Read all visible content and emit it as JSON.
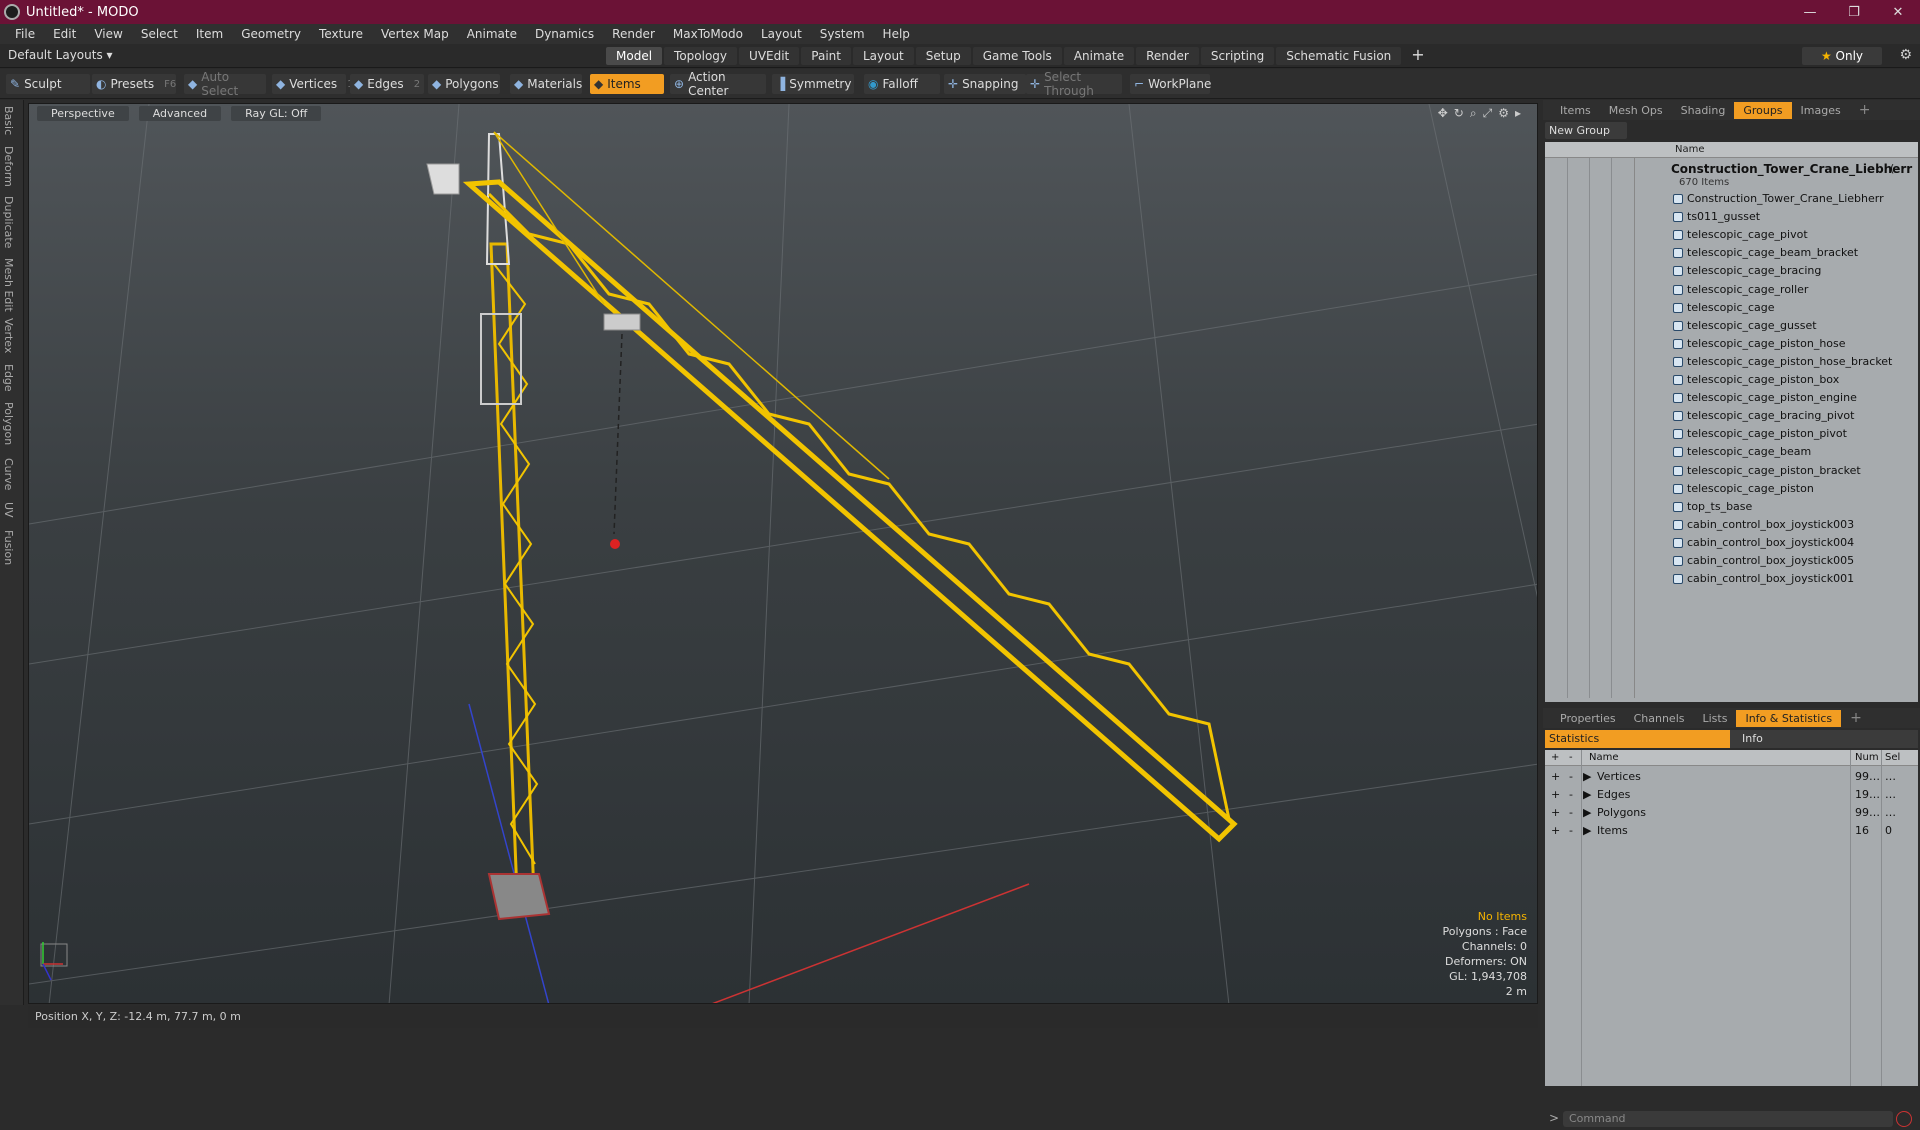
{
  "window": {
    "title": "Untitled* - MODO"
  },
  "menu": [
    "File",
    "Edit",
    "View",
    "Select",
    "Item",
    "Geometry",
    "Texture",
    "Vertex Map",
    "Animate",
    "Dynamics",
    "Render",
    "MaxToModo",
    "Layout",
    "System",
    "Help"
  ],
  "layout": {
    "layout_label": "Default Layouts ▾",
    "tabs": [
      "Model",
      "Topology",
      "UVEdit",
      "Paint",
      "Layout",
      "Setup",
      "Game Tools",
      "Animate",
      "Render",
      "Scripting",
      "Schematic Fusion"
    ],
    "active_tab": "Model",
    "only_label": "Only"
  },
  "toolbar": {
    "sculpt": "Sculpt",
    "presets": "Presets",
    "presets_key": "F6",
    "auto_select": "Auto Select",
    "vertices": "Vertices",
    "vertices_count": "1",
    "edges": "Edges",
    "edges_count": "2",
    "polygons": "Polygons",
    "materials": "Materials",
    "items": "Items",
    "action_center": "Action Center",
    "symmetry": "Symmetry",
    "falloff": "Falloff",
    "snapping": "Snapping",
    "select_through": "Select Through",
    "workplane": "WorkPlane"
  },
  "left_tabs": [
    "Basic",
    "Deform",
    "Duplicate",
    "Mesh Edit",
    "Vertex",
    "Edge",
    "Polygon",
    "Curve",
    "UV",
    "Fusion"
  ],
  "viewport": {
    "view": "Perspective",
    "shading": "Advanced",
    "raygl": "Ray GL: Off",
    "info": {
      "no_items": "No Items",
      "polygons": "Polygons : Face",
      "channels": "Channels: 0",
      "deformers": "Deformers: ON",
      "gl": "GL: 1,943,708",
      "scale": "2 m"
    },
    "accent": "#f5c518"
  },
  "status": {
    "position": "Position X, Y, Z:  -12.4 m, 77.7 m, 0 m"
  },
  "groups_panel": {
    "tabs": [
      "Items",
      "Mesh Ops",
      "Shading",
      "Groups",
      "Images"
    ],
    "active": "Groups",
    "new_group": "New Group",
    "col_name": "Name",
    "root_name": "Construction_Tower_Crane_Liebherr",
    "root_suffix": "(",
    "root_count": "670 Items",
    "items": [
      "Construction_Tower_Crane_Liebherr",
      "ts011_gusset",
      "telescopic_cage_pivot",
      "telescopic_cage_beam_bracket",
      "telescopic_cage_bracing",
      "telescopic_cage_roller",
      "telescopic_cage",
      "telescopic_cage_gusset",
      "telescopic_cage_piston_hose",
      "telescopic_cage_piston_hose_bracket",
      "telescopic_cage_piston_box",
      "telescopic_cage_piston_engine",
      "telescopic_cage_bracing_pivot",
      "telescopic_cage_piston_pivot",
      "telescopic_cage_beam",
      "telescopic_cage_piston_bracket",
      "telescopic_cage_piston",
      "top_ts_base",
      "cabin_control_box_joystick003",
      "cabin_control_box_joystick004",
      "cabin_control_box_joystick005",
      "cabin_control_box_joystick001"
    ]
  },
  "stats_panel": {
    "tabs": [
      "Properties",
      "Channels",
      "Lists",
      "Info & Statistics"
    ],
    "active": "Info & Statistics",
    "sub_a": "Statistics",
    "sub_b": "Info",
    "col_name": "Name",
    "col_num": "Num",
    "col_sel": "Sel",
    "rows": [
      {
        "name": "Vertices",
        "num": "99…",
        "sel": "…"
      },
      {
        "name": "Edges",
        "num": "19…",
        "sel": "…"
      },
      {
        "name": "Polygons",
        "num": "99…",
        "sel": "…"
      },
      {
        "name": "Items",
        "num": "16",
        "sel": "0"
      }
    ]
  },
  "command": {
    "placeholder": "Command"
  }
}
